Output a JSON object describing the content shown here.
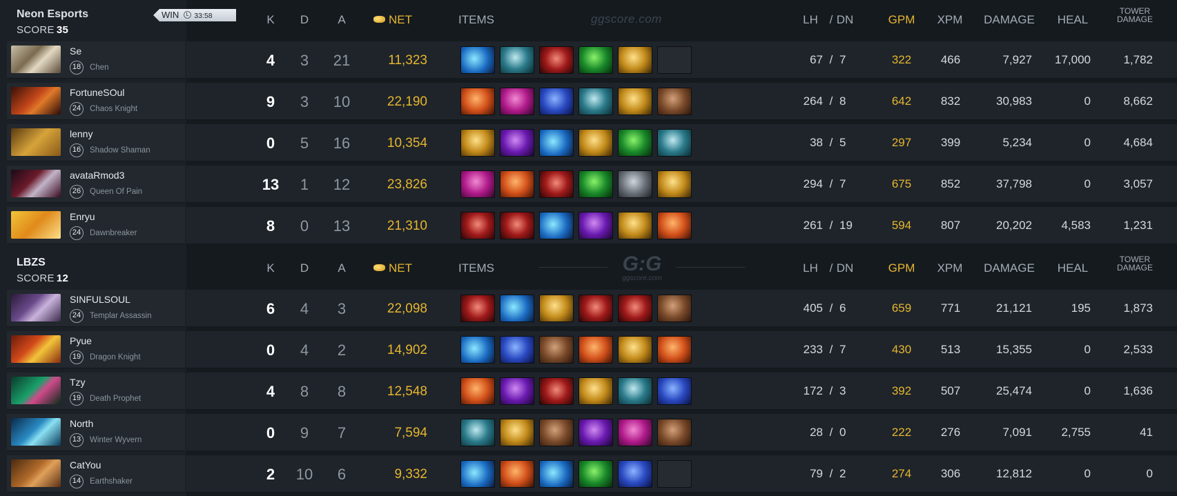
{
  "team1": {
    "name": "Neon Esports",
    "score_label": "SCORE",
    "score": "35",
    "result": "WIN",
    "duration": "33:58"
  },
  "team2": {
    "name": "LBZS",
    "score_label": "SCORE",
    "score": "12"
  },
  "columns": {
    "k": "K",
    "d": "D",
    "a": "A",
    "net": "NET",
    "items": "ITEMS",
    "lh": "LH",
    "slash": "/",
    "dn": "DN",
    "gpm": "GPM",
    "xpm": "XPM",
    "damage": "DAMAGE",
    "heal": "HEAL",
    "tower1": "TOWER",
    "tower2": "DAMAGE"
  },
  "watermark": {
    "site": "ggscore.com",
    "logo": "G:G"
  },
  "players": [
    {
      "name": "Se",
      "level": "18",
      "hero": "Chen",
      "k": "4",
      "d": "3",
      "a": "21",
      "net": "11,323",
      "lh": "67",
      "dn": "7",
      "gpm": "322",
      "xpm": "466",
      "damage": "7,927",
      "heal": "17,000",
      "tower": "1,782"
    },
    {
      "name": "FortuneSOul",
      "level": "24",
      "hero": "Chaos Knight",
      "k": "9",
      "d": "3",
      "a": "10",
      "net": "22,190",
      "lh": "264",
      "dn": "8",
      "gpm": "642",
      "xpm": "832",
      "damage": "30,983",
      "heal": "0",
      "tower": "8,662"
    },
    {
      "name": "lenny",
      "level": "16",
      "hero": "Shadow Shaman",
      "k": "0",
      "d": "5",
      "a": "16",
      "net": "10,354",
      "lh": "38",
      "dn": "5",
      "gpm": "297",
      "xpm": "399",
      "damage": "5,234",
      "heal": "0",
      "tower": "4,684"
    },
    {
      "name": "avataRmod3",
      "level": "26",
      "hero": "Queen Of Pain",
      "k": "13",
      "d": "1",
      "a": "12",
      "net": "23,826",
      "lh": "294",
      "dn": "7",
      "gpm": "675",
      "xpm": "852",
      "damage": "37,798",
      "heal": "0",
      "tower": "3,057"
    },
    {
      "name": "Enryu",
      "level": "24",
      "hero": "Dawnbreaker",
      "k": "8",
      "d": "0",
      "a": "13",
      "net": "21,310",
      "lh": "261",
      "dn": "19",
      "gpm": "594",
      "xpm": "807",
      "damage": "20,202",
      "heal": "4,583",
      "tower": "1,231"
    },
    {
      "name": "SINFULSOUL",
      "level": "24",
      "hero": "Templar Assassin",
      "k": "6",
      "d": "4",
      "a": "3",
      "net": "22,098",
      "lh": "405",
      "dn": "6",
      "gpm": "659",
      "xpm": "771",
      "damage": "21,121",
      "heal": "195",
      "tower": "1,873"
    },
    {
      "name": "Pyue",
      "level": "19",
      "hero": "Dragon Knight",
      "k": "0",
      "d": "4",
      "a": "2",
      "net": "14,902",
      "lh": "233",
      "dn": "7",
      "gpm": "430",
      "xpm": "513",
      "damage": "15,355",
      "heal": "0",
      "tower": "2,533"
    },
    {
      "name": "Tzy",
      "level": "19",
      "hero": "Death Prophet",
      "k": "4",
      "d": "8",
      "a": "8",
      "net": "12,548",
      "lh": "172",
      "dn": "3",
      "gpm": "392",
      "xpm": "507",
      "damage": "25,474",
      "heal": "0",
      "tower": "1,636"
    },
    {
      "name": "North",
      "level": "13",
      "hero": "Winter Wyvern",
      "k": "0",
      "d": "9",
      "a": "7",
      "net": "7,594",
      "lh": "28",
      "dn": "0",
      "gpm": "222",
      "xpm": "276",
      "damage": "7,091",
      "heal": "2,755",
      "tower": "41"
    },
    {
      "name": "CatYou",
      "level": "14",
      "hero": "Earthshaker",
      "k": "2",
      "d": "10",
      "a": "6",
      "net": "9,332",
      "lh": "79",
      "dn": "2",
      "gpm": "274",
      "xpm": "306",
      "damage": "12,812",
      "heal": "0",
      "tower": "0"
    }
  ]
}
